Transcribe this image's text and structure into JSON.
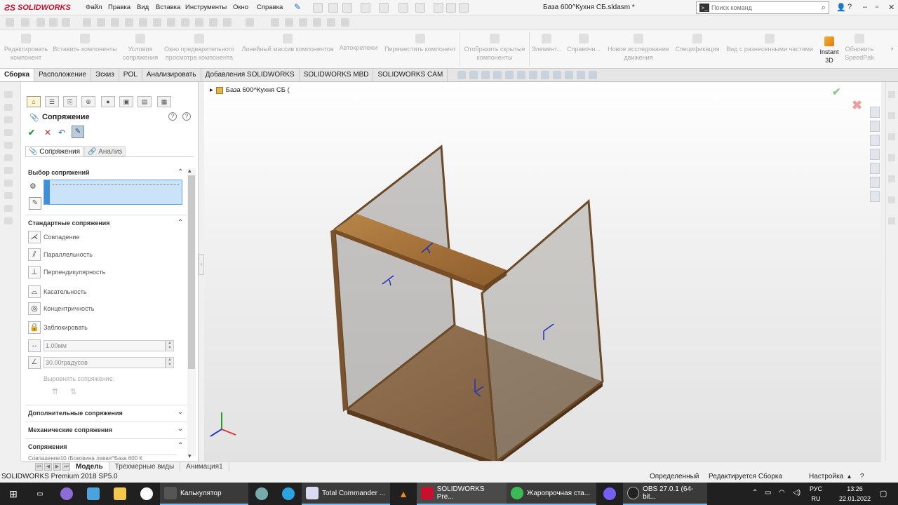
{
  "app": {
    "brand": "SOLIDWORKS"
  },
  "menu": [
    "Файл",
    "Правка",
    "Вид",
    "Вставка",
    "Инструменты",
    "Окно",
    "Справка"
  ],
  "window": {
    "doc_title": "База 600^Кухня СБ.sldasm *"
  },
  "search": {
    "placeholder": "Поиск команд"
  },
  "ribbon": [
    "Редактировать компонент",
    "Вставить компоненты",
    "Условия сопряжения",
    "Окно предварительного просмотра компонента",
    "Линейный массив компонентов",
    "Автокрепежи",
    "Переместить компонент",
    "Отобразить скрытые компоненты",
    "Элемент...",
    "Справочн...",
    "Новое исследование движения",
    "Спецификация",
    "Вид с разнесенными частями",
    "Instant 3D",
    "Обновить SpeedPak"
  ],
  "cmd_tabs": [
    "Сборка",
    "Расположение",
    "Эскиз",
    "POL",
    "Анализировать",
    "Добавления SOLIDWORKS",
    "SOLIDWORKS MBD",
    "SOLIDWORKS CAM"
  ],
  "tree": {
    "root": "База 600^Кухня СБ  ("
  },
  "panel": {
    "title": "Сопряжение",
    "subtabs": [
      "Сопряжения",
      "Анализ"
    ],
    "selection_header": "Выбор сопряжений",
    "standard_header": "Стандартные сопряжения",
    "mates": [
      "Совпадение",
      "Параллельность",
      "Перпендикулярность",
      "Касательность",
      "Концентричность",
      "Заблокировать"
    ],
    "distance_value": "1.00мм",
    "angle_value": "30.00градусов",
    "align_label": "Выровнять сопряжение:",
    "advanced_header": "Дополнительные сопряжения",
    "mechanical_header": "Механические сопряжения",
    "mates_header": "Сопряжения",
    "mates_list_item": "Совпадение10 (Боковина левая^База 600 К"
  },
  "bottom_tabs": [
    "Модель",
    "Трехмерные виды",
    "Анимация1"
  ],
  "status": {
    "product": "SOLIDWORKS Premium 2018 SP5.0",
    "state": "Определенный",
    "mode": "Редактируется Сборка",
    "settings": "Настройка"
  },
  "taskbar": {
    "apps": [
      "Калькулятор",
      "Total Commander ...",
      "SOLIDWORKS Pre...",
      "Жаропрочная ста...",
      "OBS 27.0.1 (64-bit..."
    ],
    "lang": "РУС",
    "lang2": "RU",
    "time": "13:26",
    "date": "22.01.2022"
  },
  "colors": {
    "wood": "#8a5a2a",
    "wood_light": "#c79a5a",
    "accent": "#1e6fd9"
  }
}
